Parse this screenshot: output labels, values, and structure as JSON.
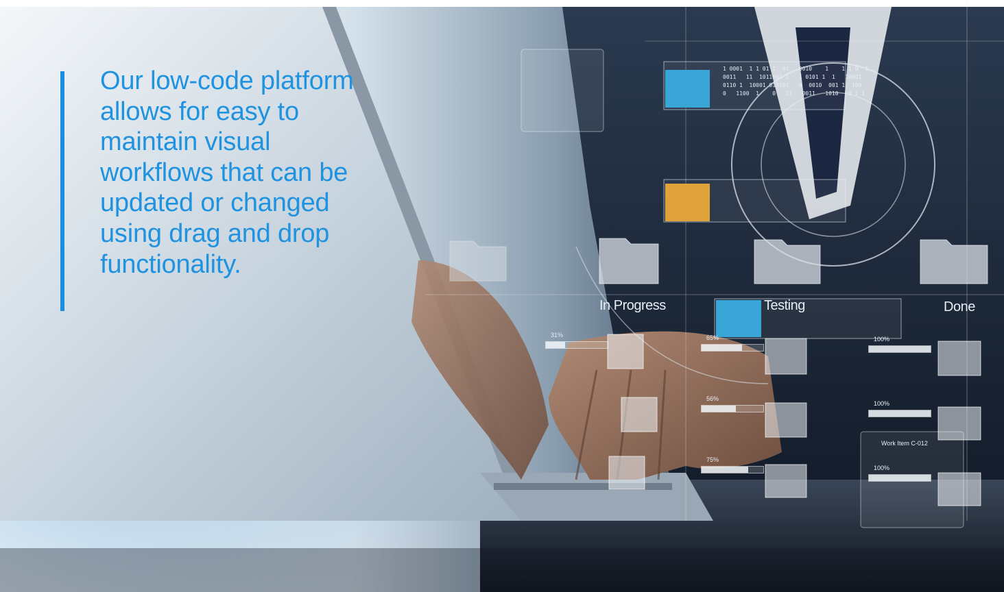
{
  "quote": {
    "text": "Our low-code platform allows for easy to maintain visual workflows that can be updated or changed using drag and drop functionality."
  },
  "workflow": {
    "columns": [
      "In Progress",
      "Testing",
      "Done"
    ],
    "progress": [
      {
        "column": "In Progress",
        "percent": 31
      },
      {
        "column": "Testing",
        "percent": 65
      },
      {
        "column": "Testing",
        "percent": 56
      },
      {
        "column": "Testing",
        "percent": 75
      },
      {
        "column": "Done",
        "percent": 100
      },
      {
        "column": "Done",
        "percent": 100
      },
      {
        "column": "Done",
        "percent": 100
      }
    ],
    "work_item": "Work Item C-012",
    "binary_rows": [
      "1 0001  1 1 01 1  01   0010    1    1 1 0  1",
      "0011   11  1011001 1   1 0101 1  1   10001",
      "0110 1  10001 010101   0  0010  001 1  100",
      "0   1100  1    0   11   0011   1010   0 1 1"
    ],
    "colors": {
      "accent": "#1f92e0",
      "card_blue": "#3aa6d8",
      "card_orange": "#e0a23a"
    }
  }
}
